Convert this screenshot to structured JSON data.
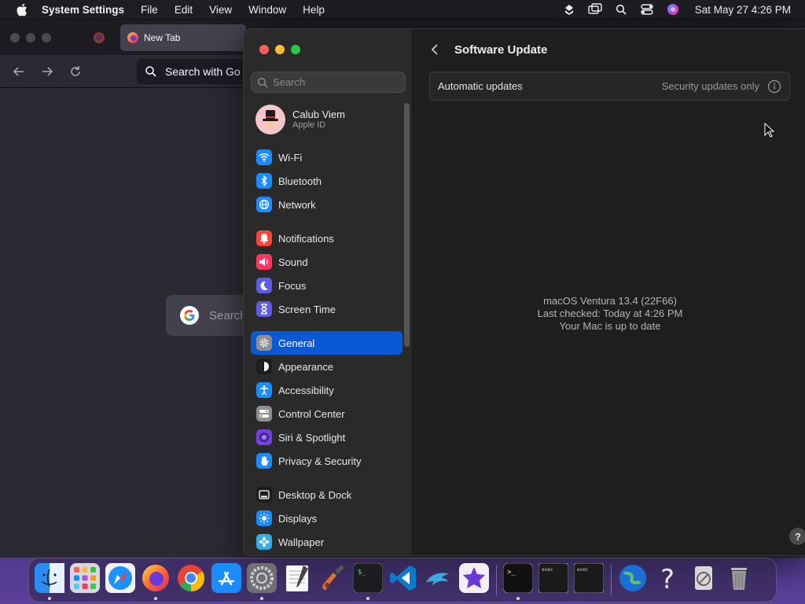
{
  "menubar": {
    "app_name": "System Settings",
    "menus": [
      "File",
      "Edit",
      "View",
      "Window",
      "Help"
    ],
    "clock": "Sat May 27  4:26 PM"
  },
  "firefox": {
    "tab_title": "New Tab",
    "url_placeholder": "Search with Go",
    "search_placeholder": "Search"
  },
  "settings": {
    "search_placeholder": "Search",
    "profile": {
      "name": "Calub Viem",
      "subtitle": "Apple ID"
    },
    "groups": [
      [
        {
          "label": "Wi-Fi",
          "icon": "wifi-icon",
          "color": "#1a8cff"
        },
        {
          "label": "Bluetooth",
          "icon": "bluetooth-icon",
          "color": "#1a8cff"
        },
        {
          "label": "Network",
          "icon": "globe-icon",
          "color": "#1a8cff"
        }
      ],
      [
        {
          "label": "Notifications",
          "icon": "bell-icon",
          "color": "#ff453a"
        },
        {
          "label": "Sound",
          "icon": "speaker-icon",
          "color": "#ff375f"
        },
        {
          "label": "Focus",
          "icon": "moon-icon",
          "color": "#5e5ce6"
        },
        {
          "label": "Screen Time",
          "icon": "hourglass-icon",
          "color": "#5e5ce6"
        }
      ],
      [
        {
          "label": "General",
          "icon": "gear-icon",
          "color": "#8e8e93",
          "selected": true
        },
        {
          "label": "Appearance",
          "icon": "appearance-icon",
          "color": "#1c1c1e"
        },
        {
          "label": "Accessibility",
          "icon": "accessibility-icon",
          "color": "#1a8cff"
        },
        {
          "label": "Control Center",
          "icon": "toggles-icon",
          "color": "#8e8e93"
        },
        {
          "label": "Siri & Spotlight",
          "icon": "siri-icon",
          "color": "#7a3fe0"
        },
        {
          "label": "Privacy & Security",
          "icon": "hand-icon",
          "color": "#1a8cff"
        }
      ],
      [
        {
          "label": "Desktop & Dock",
          "icon": "dock-icon",
          "color": "#1c1c1e"
        },
        {
          "label": "Displays",
          "icon": "sun-icon",
          "color": "#1a8cff"
        },
        {
          "label": "Wallpaper",
          "icon": "flower-icon",
          "color": "#32ade6"
        }
      ]
    ],
    "page_title": "Software Update",
    "automatic_updates": {
      "label": "Automatic updates",
      "value": "Security updates only"
    },
    "status": {
      "version": "macOS Ventura 13.4 (22F66)",
      "last_checked": "Last checked: Today at 4:26 PM",
      "message": "Your Mac is up to date"
    },
    "help_label": "?"
  },
  "dock": {
    "apps": [
      {
        "name": "finder",
        "running": true
      },
      {
        "name": "launchpad",
        "running": false
      },
      {
        "name": "safari",
        "running": false
      },
      {
        "name": "firefox",
        "running": true
      },
      {
        "name": "chrome",
        "running": false
      },
      {
        "name": "app-store",
        "running": false
      },
      {
        "name": "system-settings",
        "running": true
      },
      {
        "name": "textedit",
        "running": false
      },
      {
        "name": "garageband",
        "running": false
      },
      {
        "name": "terminal-green",
        "running": true
      },
      {
        "name": "vscode",
        "running": false
      },
      {
        "name": "dolphin",
        "running": false
      },
      {
        "name": "imovie",
        "running": false
      }
    ],
    "apps2": [
      {
        "name": "terminal",
        "running": true
      },
      {
        "name": "exec-1",
        "running": false
      },
      {
        "name": "exec-2",
        "running": false
      }
    ],
    "apps3": [
      {
        "name": "network-globe",
        "running": false
      },
      {
        "name": "help-question",
        "running": false
      },
      {
        "name": "compressor",
        "running": false
      },
      {
        "name": "trash",
        "running": false
      }
    ]
  }
}
